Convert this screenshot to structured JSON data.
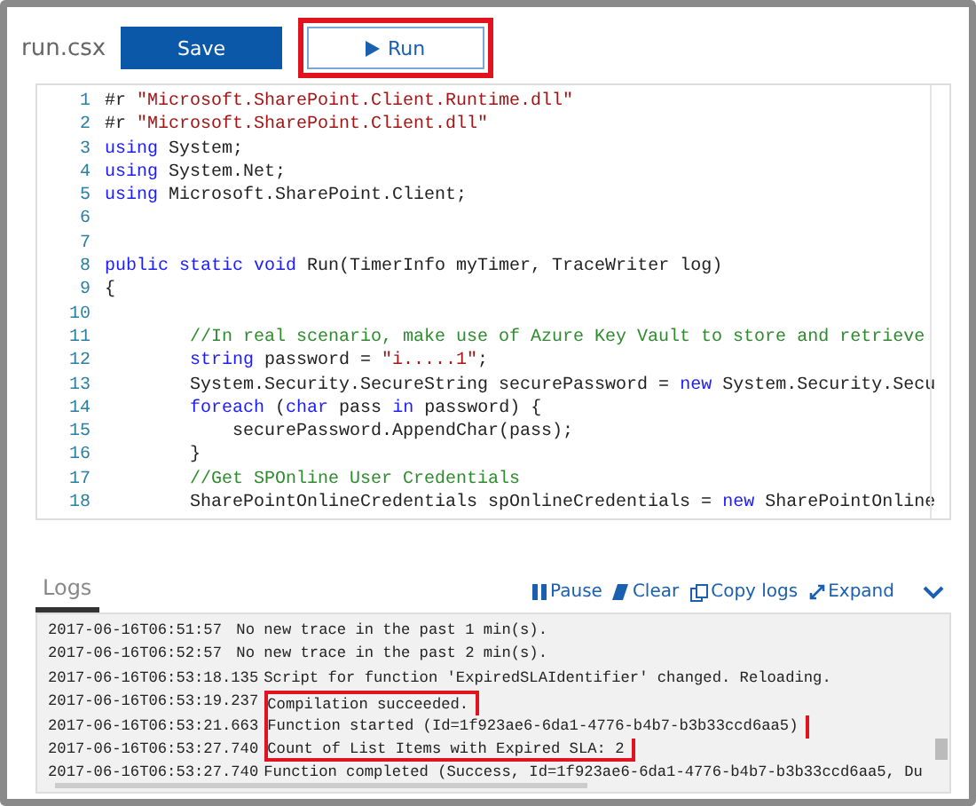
{
  "file_name": "run.csx",
  "buttons": [
    {
      "label": "Save",
      "kind": "primary",
      "highlighted": false
    },
    {
      "label": "Run",
      "kind": "run",
      "highlighted": true
    }
  ],
  "editor": {
    "lines": [
      {
        "number": "1",
        "tokens": [
          {
            "kind": "plain",
            "text": "#r "
          },
          {
            "kind": "string",
            "text": "\"Microsoft.SharePoint.Client.Runtime.dll\""
          }
        ]
      },
      {
        "number": "2",
        "tokens": [
          {
            "kind": "plain",
            "text": "#r "
          },
          {
            "kind": "string",
            "text": "\"Microsoft.SharePoint.Client.dll\""
          }
        ]
      },
      {
        "number": "3",
        "tokens": [
          {
            "kind": "keyword",
            "text": "using"
          },
          {
            "kind": "plain",
            "text": " System;"
          }
        ]
      },
      {
        "number": "4",
        "tokens": [
          {
            "kind": "keyword",
            "text": "using"
          },
          {
            "kind": "plain",
            "text": " System.Net;"
          }
        ]
      },
      {
        "number": "5",
        "tokens": [
          {
            "kind": "keyword",
            "text": "using"
          },
          {
            "kind": "plain",
            "text": " Microsoft.SharePoint.Client;"
          }
        ]
      },
      {
        "number": "6"
      },
      {
        "number": "7"
      },
      {
        "number": "8",
        "tokens": [
          {
            "kind": "keyword",
            "text": "public static void"
          },
          {
            "kind": "plain",
            "text": " Run(TimerInfo myTimer, TraceWriter log)"
          }
        ]
      },
      {
        "number": "9",
        "tokens": [
          {
            "kind": "plain",
            "text": "{"
          }
        ]
      },
      {
        "number": "10"
      },
      {
        "number": "11",
        "tokens": [
          {
            "kind": "comment",
            "text": "        //In real scenario, make use of Azure Key Vault to store and retrieve"
          }
        ]
      },
      {
        "number": "12",
        "tokens": [
          {
            "kind": "keyword",
            "text": "        string"
          },
          {
            "kind": "plain",
            "text": " password = "
          },
          {
            "kind": "string",
            "text": "\"i.....1\""
          },
          {
            "kind": "plain",
            "text": ";"
          }
        ]
      },
      {
        "number": "13",
        "tokens": [
          {
            "kind": "plain",
            "text": "        System.Security.SecureString securePassword = "
          },
          {
            "kind": "keyword",
            "text": "new"
          },
          {
            "kind": "plain",
            "text": " System.Security.Secu"
          }
        ]
      },
      {
        "number": "14",
        "tokens": [
          {
            "kind": "keyword",
            "text": "        foreach"
          },
          {
            "kind": "plain",
            "text": " ("
          },
          {
            "kind": "keyword",
            "text": "char"
          },
          {
            "kind": "plain",
            "text": " pass "
          },
          {
            "kind": "keyword",
            "text": "in"
          },
          {
            "kind": "plain",
            "text": " password) {"
          }
        ]
      },
      {
        "number": "15",
        "tokens": [
          {
            "kind": "plain",
            "text": "            securePassword.AppendChar(pass);"
          }
        ]
      },
      {
        "number": "16",
        "tokens": [
          {
            "kind": "plain",
            "text": "        }"
          }
        ]
      },
      {
        "number": "17",
        "tokens": [
          {
            "kind": "comment",
            "text": "        //Get SPOnline User Credentials"
          }
        ]
      },
      {
        "number": "18",
        "tokens": [
          {
            "kind": "plain",
            "text": "        SharePointOnlineCredentials spOnlineCredentials = "
          },
          {
            "kind": "keyword",
            "text": "new"
          },
          {
            "kind": "plain",
            "text": " SharePointOnline"
          }
        ]
      }
    ]
  },
  "logs": {
    "tab": {
      "label": "Logs",
      "selected": true
    },
    "actions": [
      {
        "label": "Pause",
        "kind": "pause"
      },
      {
        "label": "Clear",
        "kind": "clear"
      },
      {
        "label": "Copy logs",
        "kind": "copy"
      },
      {
        "label": "Expand",
        "kind": "expand"
      },
      {
        "kind": "collapse"
      }
    ],
    "lines": [
      {
        "time": "2017-06-16T06:51:57",
        "message": " No new trace in the past 1 min(s).",
        "highlighted": false
      },
      {
        "time": "2017-06-16T06:52:57",
        "message": " No new trace in the past 2 min(s).",
        "highlighted": false
      },
      {
        "time": "2017-06-16T06:53:18.135",
        "message": "Script for function 'ExpiredSLAIdentifier' changed. Reloading.",
        "highlighted": false
      },
      {
        "time": "2017-06-16T06:53:19.237",
        "message": "Compilation succeeded.",
        "highlighted": true
      },
      {
        "time": "2017-06-16T06:53:21.663",
        "message": "Function started (Id=1f923ae6-6da1-4776-b4b7-b3b33ccd6aa5)",
        "highlighted": true
      },
      {
        "time": "2017-06-16T06:53:27.740",
        "message": "Count of List Items with Expired SLA: 2",
        "highlighted": true
      },
      {
        "time": "2017-06-16T06:53:27.740",
        "message": "Function completed (Success, Id=1f923ae6-6da1-4776-b4b7-b3b33ccd6aa5, Du",
        "highlighted": false
      }
    ]
  }
}
